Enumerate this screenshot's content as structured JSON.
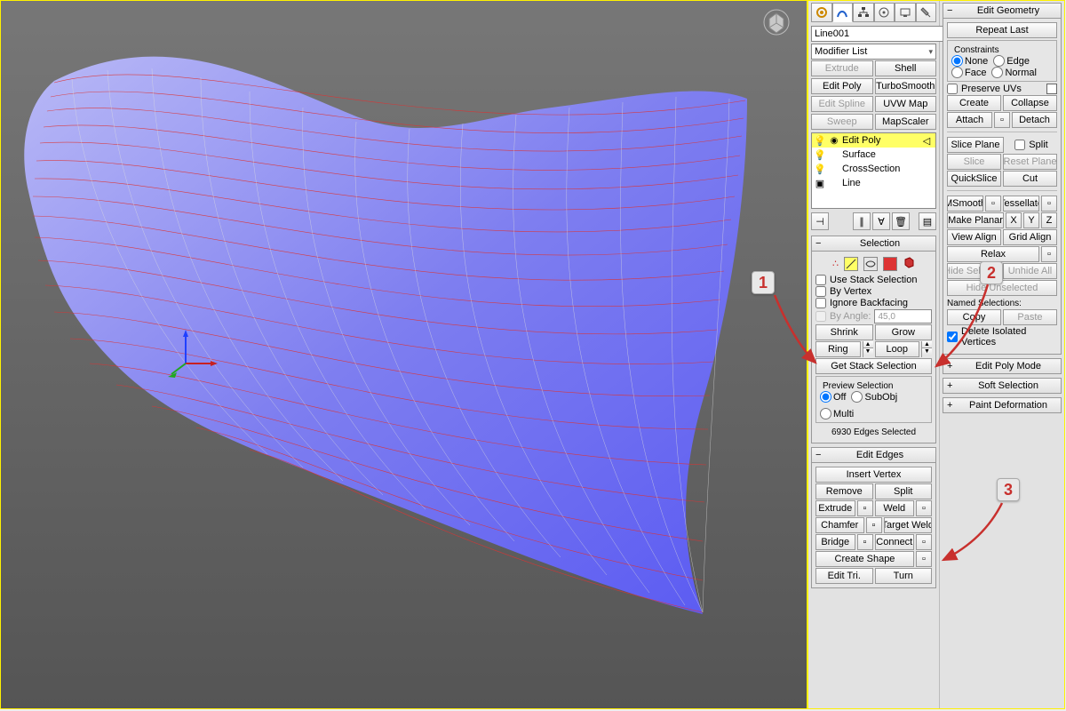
{
  "object_name": "Line001",
  "modifier_list_label": "Modifier List",
  "quick_buttons": {
    "extrude": "Extrude",
    "shell": "Shell",
    "edit_poly": "Edit Poly",
    "turbosmooth": "TurboSmooth",
    "edit_spline": "Edit Spline",
    "uvw_map": "UVW Map",
    "sweep": "Sweep",
    "mapscaler": "MapScaler"
  },
  "stack": [
    "Edit Poly",
    "Surface",
    "CrossSection",
    "Line"
  ],
  "selection": {
    "title": "Selection",
    "use_stack": "Use Stack Selection",
    "by_vertex": "By Vertex",
    "ignore_backfacing": "Ignore Backfacing",
    "by_angle": "By Angle:",
    "angle_val": "45,0",
    "shrink": "Shrink",
    "grow": "Grow",
    "ring": "Ring",
    "loop": "Loop",
    "get_stack": "Get Stack Selection",
    "preview": "Preview Selection",
    "off": "Off",
    "subobj": "SubObj",
    "multi": "Multi",
    "count": "6930 Edges Selected"
  },
  "edit_edges": {
    "title": "Edit Edges",
    "insert_vertex": "Insert Vertex",
    "remove": "Remove",
    "split": "Split",
    "extrude": "Extrude",
    "weld": "Weld",
    "chamfer": "Chamfer",
    "target_weld": "Target Weld",
    "bridge": "Bridge",
    "connect": "Connect",
    "create_shape": "Create Shape",
    "edit_tri": "Edit Tri.",
    "turn": "Turn"
  },
  "edit_geometry": {
    "title": "Edit Geometry",
    "repeat": "Repeat Last",
    "constraints": "Constraints",
    "none": "None",
    "edge": "Edge",
    "face": "Face",
    "normal": "Normal",
    "preserve_uvs": "Preserve UVs",
    "create": "Create",
    "collapse": "Collapse",
    "attach": "Attach",
    "detach": "Detach",
    "slice_plane": "Slice Plane",
    "split": "Split",
    "slice": "Slice",
    "reset_plane": "Reset Plane",
    "quickslice": "QuickSlice",
    "cut": "Cut",
    "msmooth": "MSmooth",
    "tessellate": "Tessellate",
    "make_planar": "Make Planar",
    "x": "X",
    "y": "Y",
    "z": "Z",
    "view_align": "View Align",
    "grid_align": "Grid Align",
    "relax": "Relax",
    "hide_sel": "Hide Selected",
    "unhide_all": "Unhide All",
    "hide_unsel": "Hide Unselected",
    "named_sel": "Named Selections:",
    "copy": "Copy",
    "paste": "Paste",
    "delete_iso": "Delete Isolated Vertices",
    "r_editpoly": "Edit Poly Mode",
    "r_softsel": "Soft Selection",
    "r_paintdef": "Paint Deformation"
  },
  "callouts": {
    "1": "1",
    "2": "2",
    "3": "3"
  }
}
